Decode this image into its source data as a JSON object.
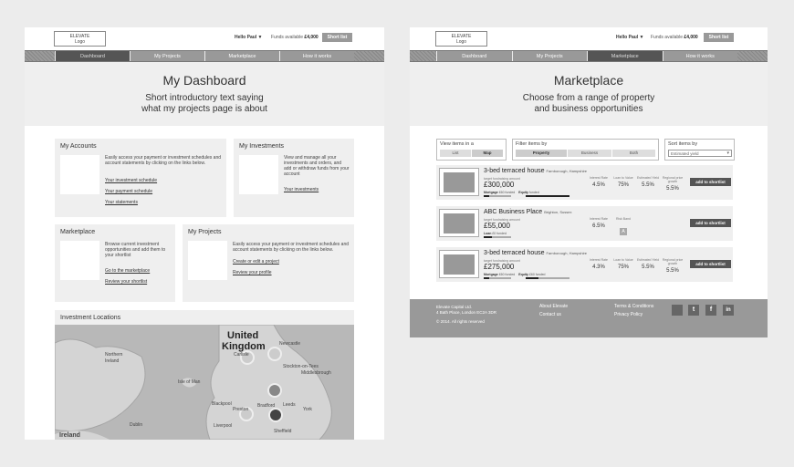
{
  "dashboard": {
    "logo": {
      "line1": "ELEVATE",
      "line2": "Logo"
    },
    "hello": "Hello Paul ▼",
    "funds_label": "Funds available",
    "funds_value": "£4,000",
    "shortlist_btn": "Short list",
    "nav": [
      "Dashboard",
      "My Projects",
      "Marketplace",
      "How it works"
    ],
    "hero_title": "My Dashboard",
    "hero_text": "Short introductory text saying\nwhat my projects page is about",
    "accounts": {
      "title": "My Accounts",
      "text": "Easily access your payment or investment schedules and account statements by clicking on the links below.",
      "links": [
        "Your investment schedule",
        "Your payment schedule",
        "Your statements"
      ]
    },
    "investments": {
      "title": "My Investments",
      "text": "View and manage all your investments and orders, and add or withdraw funds from your account",
      "links": [
        "Your investments"
      ]
    },
    "marketplace": {
      "title": "Marketplace",
      "text": "Browse current investment opportunities and add them to your shortlist",
      "links": [
        "Go to the marketplace",
        "Review your shortlist"
      ]
    },
    "projects": {
      "title": "My Projects",
      "text": "Easily access your payment or investment schedules and account statements by clicking on the links below.",
      "links": [
        "Create or edit a project",
        "Review your profile"
      ]
    },
    "locations": {
      "title": "Investment Locations",
      "map_labels": [
        "United",
        "Kingdom",
        "Northern",
        "Ireland",
        "Isle of Man",
        "Blackpool",
        "Preston",
        "Bradford",
        "Leeds",
        "Liverpool",
        "Sheffield",
        "Stockton-on-Tees",
        "Middlesbrough",
        "Newcastle",
        "Dublin",
        "Ireland",
        "Carlisle",
        "York"
      ]
    }
  },
  "market": {
    "logo": {
      "line1": "ELEVATE",
      "line2": "Logo"
    },
    "hello": "Hello Paul ▼",
    "funds_label": "Funds available",
    "funds_value": "£4,000",
    "shortlist_btn": "Short list",
    "nav": [
      "Dashboard",
      "My Projects",
      "Marketplace",
      "How it works"
    ],
    "hero_title": "Marketplace",
    "hero_text": "Choose from a range of property\nand business opportunities",
    "view": {
      "label": "View items in a",
      "options": [
        "List",
        "Map"
      ]
    },
    "filter": {
      "label": "Filter items by",
      "options": [
        "Property",
        "Business",
        "Both"
      ]
    },
    "sort": {
      "label": "Sort items by",
      "value": "Estimated yield"
    },
    "items": [
      {
        "title": "3-bed terraced house",
        "location": "Farnborough, Hampshire",
        "sub": "target fundraising amount",
        "price": "£300,000",
        "meta1": "Mortgage",
        "meta1v": "£60 funded",
        "meta2": "Equity",
        "meta2v": "funded",
        "stats": [
          {
            "label": "Interest Rate",
            "value": "4.5%"
          },
          {
            "label": "Loan to Value",
            "value": "75%"
          },
          {
            "label": "Estimated Yield",
            "value": "5.5%"
          },
          {
            "label": "Regional price growth",
            "value": "5.5%"
          }
        ],
        "btn": "add to shortlist",
        "bar1": 0.2,
        "bar2": 1.0
      },
      {
        "title": "ABC Business Place",
        "location": "Brighton, Sussex",
        "sub": "target fundraising amount",
        "price": "£55,000",
        "meta1": "Loan",
        "meta1v": "£0 funded",
        "meta2": "",
        "meta2v": "",
        "stats": [
          {
            "label": "Interest Rate",
            "value": "6.5%"
          },
          {
            "label": "Risk Band",
            "value": "A"
          }
        ],
        "btn": "add to shortlist",
        "bar1": 0.3,
        "bar2": 0
      },
      {
        "title": "3-bed terraced house",
        "location": "Farnborough, Hampshire",
        "sub": "target fundraising amount",
        "price": "£275,000",
        "meta1": "Mortgage",
        "meta1v": "£60 funded",
        "meta2": "Equity",
        "meta2v": "£60 funded",
        "stats": [
          {
            "label": "Interest Rate",
            "value": "4.3%"
          },
          {
            "label": "Loan to Value",
            "value": "75%"
          },
          {
            "label": "Estimated Yield",
            "value": "5.5%"
          },
          {
            "label": "Regional price growth",
            "value": "5.5%"
          }
        ],
        "btn": "add to shortlist",
        "bar1": 0.2,
        "bar2": 0.3
      }
    ],
    "footer": {
      "company": "Elevate Capital Ltd.",
      "address": "4 Bath Place, London EC2A 3DR",
      "copyright": "© 2014. All rights reserved",
      "about": "About Elevate",
      "contact": "Contact us",
      "terms": "Terms & Conditions",
      "privacy": "Privacy Policy"
    }
  }
}
